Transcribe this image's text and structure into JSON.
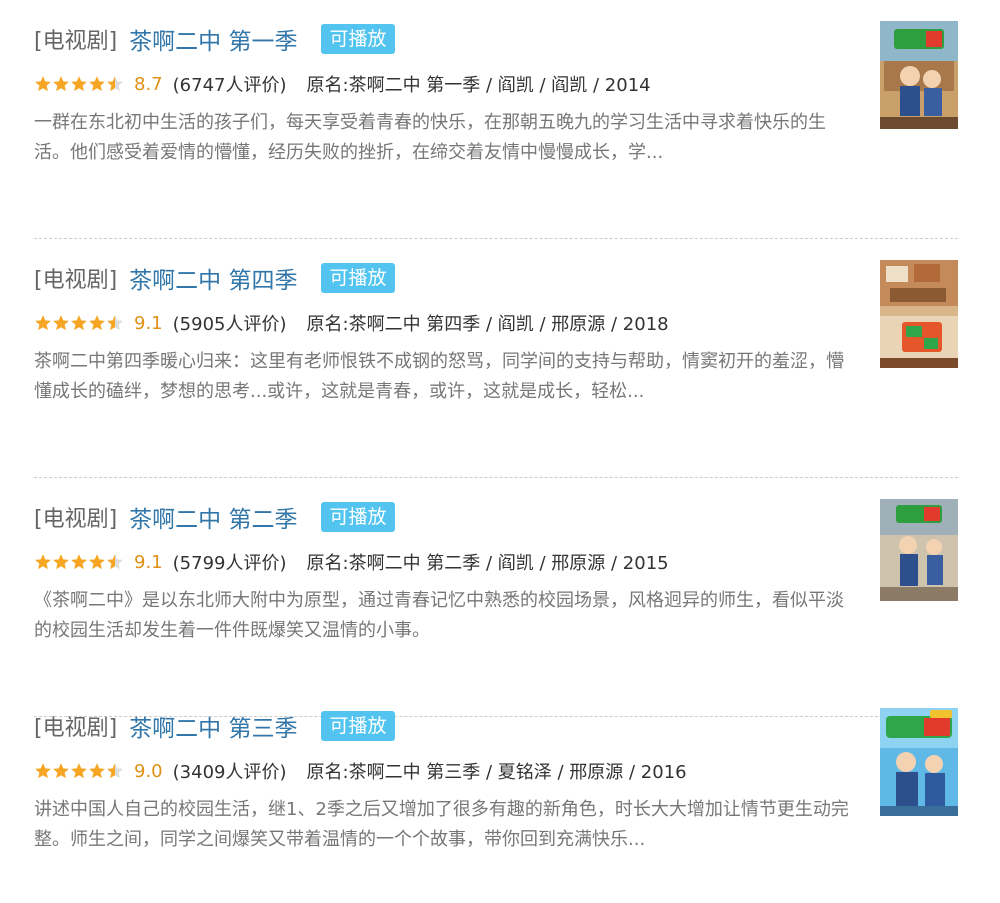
{
  "results": [
    {
      "type_tag": "[电视剧]",
      "title": "茶啊二中 第一季",
      "badge": "可播放",
      "stars": 4.5,
      "score": "8.7",
      "count": "(6747人评价)",
      "meta": "原名:茶啊二中 第一季 / 阎凯 / 阎凯 / 2014",
      "description": "一群在东北初中生活的孩子们，每天享受着青春的快乐，在那朝五晚九的学习生活中寻求着快乐的生活。他们感受着爱情的懵懂，经历失败的挫折，在缔交着友情中慢慢成长，学..."
    },
    {
      "type_tag": "[电视剧]",
      "title": "茶啊二中 第四季",
      "badge": "可播放",
      "stars": 4.5,
      "score": "9.1",
      "count": "(5905人评价)",
      "meta": "原名:茶啊二中 第四季 / 阎凯 / 邢原源 / 2018",
      "description": "茶啊二中第四季暖心归来：这里有老师恨铁不成钢的怒骂，同学间的支持与帮助，情窦初开的羞涩，懵懂成长的磕绊，梦想的思考...或许，这就是青春，或许，这就是成长，轻松..."
    },
    {
      "type_tag": "[电视剧]",
      "title": "茶啊二中 第二季",
      "badge": "可播放",
      "stars": 4.5,
      "score": "9.1",
      "count": "(5799人评价)",
      "meta": "原名:茶啊二中 第二季 / 阎凯 / 邢原源 / 2015",
      "description": "《茶啊二中》是以东北师大附中为原型，通过青春记忆中熟悉的校园场景，风格迥异的师生，看似平淡的校园生活却发生着一件件既爆笑又温情的小事。"
    },
    {
      "type_tag": "[电视剧]",
      "title": "茶啊二中 第三季",
      "badge": "可播放",
      "stars": 4.5,
      "score": "9.0",
      "count": "(3409人评价)",
      "meta": "原名:茶啊二中 第三季 / 夏铭泽 / 邢原源 / 2016",
      "description": "讲述中国人自己的校园生活，继1、2季之后又增加了很多有趣的新角色，时长大大增加让情节更生动完整。师生之间，同学之间爆笑又带着温情的一个个故事，带你回到充满快乐..."
    }
  ],
  "colors": {
    "title_link": "#3377aa",
    "badge_bg": "#53c4ef",
    "star": "#f6a623",
    "score": "#e09015",
    "description": "#777777"
  }
}
